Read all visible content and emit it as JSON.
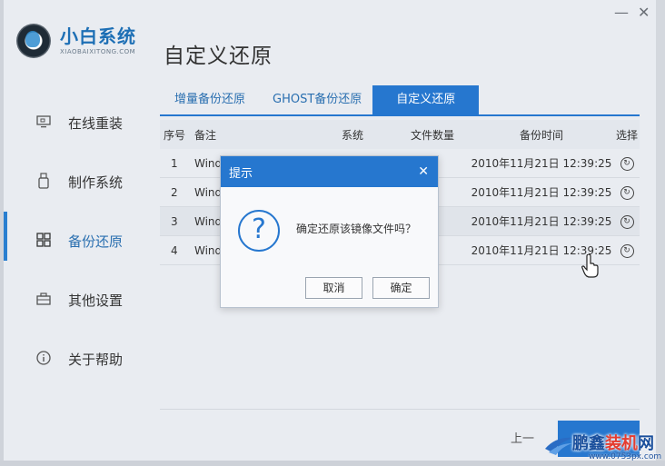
{
  "app": {
    "name": "小白系统",
    "domain": "XIAOBAIXITONG.COM"
  },
  "window": {
    "minimize": "—",
    "close": "✕"
  },
  "sidebar": {
    "items": [
      {
        "label": "在线重装",
        "icon": "monitor-icon"
      },
      {
        "label": "制作系统",
        "icon": "usb-drive-icon"
      },
      {
        "label": "备份还原",
        "icon": "grid-icon",
        "active": true
      },
      {
        "label": "其他设置",
        "icon": "toolbox-icon"
      },
      {
        "label": "关于帮助",
        "icon": "info-icon"
      }
    ]
  },
  "page": {
    "title": "自定义还原"
  },
  "tabs": [
    {
      "label": "增量备份还原"
    },
    {
      "label": "GHOST备份还原"
    },
    {
      "label": "自定义还原",
      "active": true
    }
  ],
  "table": {
    "headers": {
      "idx": "序号",
      "note": "备注",
      "sys": "系统",
      "count": "文件数量",
      "time": "备份时间",
      "select": "选择"
    },
    "rows": [
      {
        "idx": "1",
        "note": "Wind",
        "time": "2010年11月21日 12:39:25"
      },
      {
        "idx": "2",
        "note": "Wind",
        "time": "2010年11月21日 12:39:25"
      },
      {
        "idx": "3",
        "note": "Wind",
        "time": "2010年11月21日 12:39:25"
      },
      {
        "idx": "4",
        "note": "Wind",
        "time": "2010年11月21日 12:39:25"
      }
    ]
  },
  "footer": {
    "prev": "上一"
  },
  "dialog": {
    "title": "提示",
    "close": "✕",
    "icon": "?",
    "message": "确定还原该镜像文件吗？",
    "cancel": "取消",
    "confirm": "确定"
  },
  "watermark": {
    "brand_a": "鹏鑫",
    "brand_b": "装机",
    "brand_c": "网",
    "url": "www.0753px.com"
  },
  "colors": {
    "accent": "#2677cf",
    "background": "#e9ecf1"
  }
}
